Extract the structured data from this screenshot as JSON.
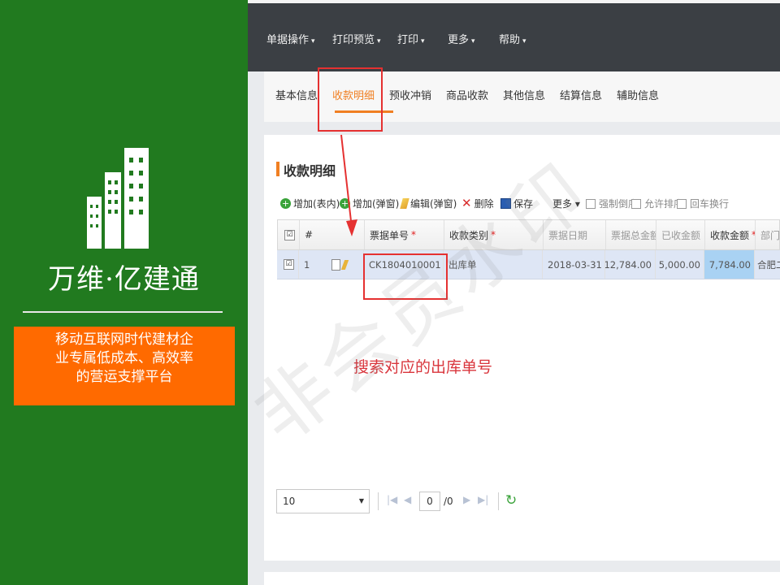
{
  "brand": {
    "name": "万维·亿建通",
    "tagline": "移动互联网时代建材企\n业专属低成本、高效率\n的营运支撑平台"
  },
  "top_menu": [
    {
      "label": "单据操作",
      "caret": "▾"
    },
    {
      "label": "打印预览",
      "caret": "▾"
    },
    {
      "label": "打印",
      "caret": "▾"
    },
    {
      "label": "更多",
      "caret": "▾"
    },
    {
      "label": "帮助",
      "caret": "▾"
    }
  ],
  "tabs": [
    {
      "label": "基本信息",
      "active": false
    },
    {
      "label": "收款明细",
      "active": true
    },
    {
      "label": "预收冲销",
      "active": false
    },
    {
      "label": "商品收款",
      "active": false
    },
    {
      "label": "其他信息",
      "active": false
    },
    {
      "label": "结算信息",
      "active": false
    },
    {
      "label": "辅助信息",
      "active": false
    }
  ],
  "panel": {
    "title": "收款明细"
  },
  "toolbar": {
    "add_inline": "增加(表内)",
    "add_popup": "增加(弹窗)",
    "edit_popup": "编辑(弹窗)",
    "delete": "删除",
    "save": "保存",
    "more": "更多 ▾",
    "force_reverse": "强制倒序",
    "allow_sort": "允许排序",
    "enter_newline": "回车换行"
  },
  "grid": {
    "headers": {
      "check": "☑",
      "index": "#",
      "doc_no": "票据单号",
      "type": "收款类别",
      "date": "票据日期",
      "total": "票据总金额",
      "received": "已收金额",
      "amount": "收款金额",
      "dept": "部门名"
    },
    "required_mark": "*",
    "rows": [
      {
        "check": "☑",
        "index": "1",
        "doc_no": "CK1804010001",
        "type": "出库单",
        "date": "2018-03-31",
        "total": "12,784.00",
        "received": "5,000.00",
        "amount": "7,784.00",
        "dept": "合肥二"
      }
    ]
  },
  "pager": {
    "page_size": "10",
    "current_page": "0",
    "total_pages": "/0"
  },
  "annotation": {
    "text": "搜索对应的出库单号"
  },
  "watermark": "非会员水印",
  "colors": {
    "brand_green": "#217a1f",
    "tagline_orange": "#ff6a00",
    "accent_orange": "#f07f22",
    "annotation_red": "#e53131"
  }
}
